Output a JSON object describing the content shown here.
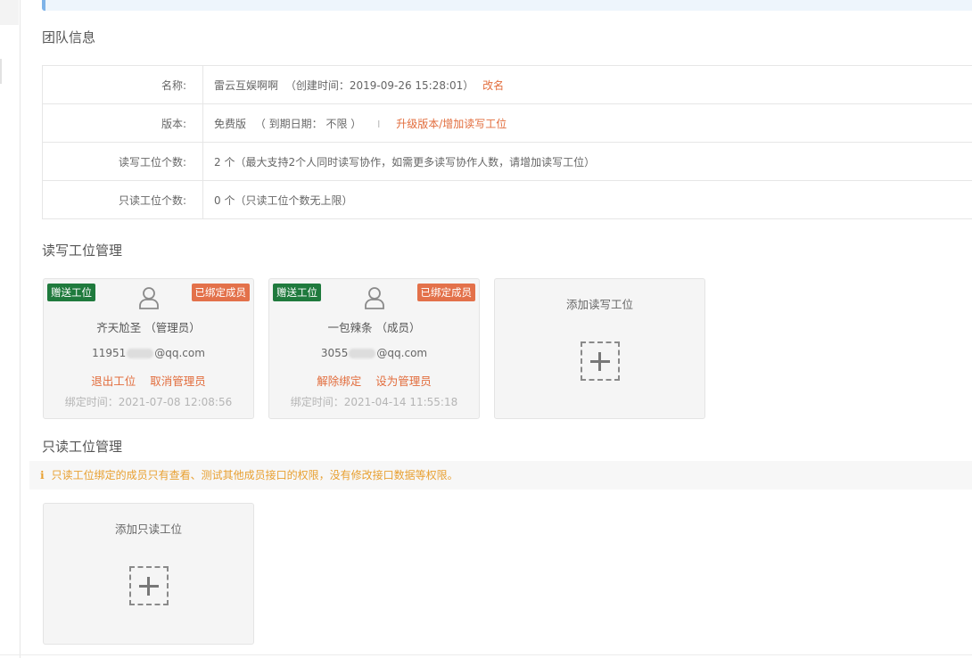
{
  "team_info": {
    "title": "团队信息",
    "rows": [
      {
        "key": "名称:",
        "value": "雷云互娱啊啊",
        "extra": "（创建时间：2019-09-26 15:28:01）",
        "link": "改名"
      },
      {
        "key": "版本:",
        "value": "免费版",
        "extra": "（ 到期日期： 不限 ）",
        "sep": "I",
        "link": "升级版本/增加读写工位"
      },
      {
        "key": "读写工位个数:",
        "value": "2 个（最大支持2个人同时读写协作，如需更多读写协作人数，请增加读写工位）"
      },
      {
        "key": "只读工位个数:",
        "value": "0 个（只读工位个数无上限）"
      }
    ]
  },
  "rw_section": {
    "title": "读写工位管理",
    "cards": [
      {
        "badge_gift": "赠送工位",
        "badge_bound": "已绑定成员",
        "name": "齐天尬圣 （管理员）",
        "email_prefix": "11951",
        "email_suffix": "@qq.com",
        "actions": [
          "退出工位",
          "取消管理员"
        ],
        "bind_time": "绑定时间：2021-07-08 12:08:56"
      },
      {
        "badge_gift": "赠送工位",
        "badge_bound": "已绑定成员",
        "name": "一包辣条 （成员）",
        "email_prefix": "3055",
        "email_suffix": "@qq.com",
        "actions": [
          "解除绑定",
          "设为管理员"
        ],
        "bind_time": "绑定时间：2021-04-14 11:55:18"
      }
    ],
    "add_label": "添加读写工位"
  },
  "ro_section": {
    "title": "只读工位管理",
    "tip_icon": "info-icon",
    "tip": "只读工位绑定的成员只有查看、测试其他成员接口的权限，没有修改接口数据等权限。",
    "add_label": "添加只读工位"
  },
  "colors": {
    "link": "#e26d3d",
    "gift_badge": "#1f7a3d",
    "bound_badge": "#e3714a",
    "tip_text": "#e8a031"
  }
}
